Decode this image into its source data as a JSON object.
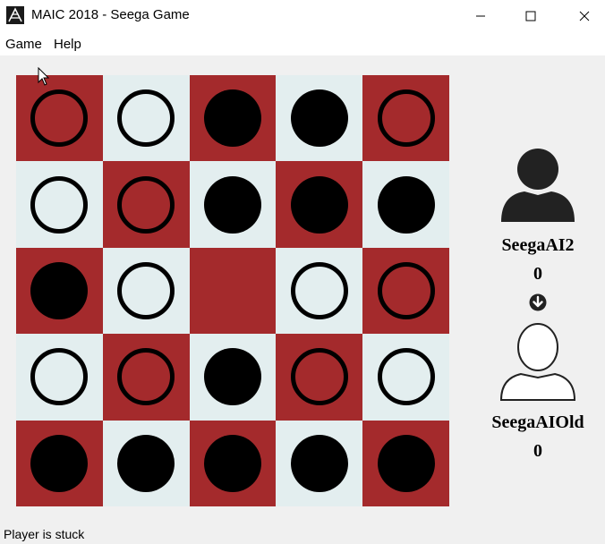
{
  "window": {
    "title": "MAIC 2018 - Seega Game"
  },
  "menu": {
    "items": [
      "Game",
      "Help"
    ]
  },
  "board": {
    "rows": [
      [
        "white",
        "white",
        "black",
        "black",
        "white"
      ],
      [
        "white",
        "white",
        "black",
        "black",
        "black"
      ],
      [
        "black",
        "white",
        "empty",
        "white",
        "white"
      ],
      [
        "white",
        "white",
        "black",
        "white",
        "white"
      ],
      [
        "black",
        "black",
        "black",
        "black",
        "black"
      ]
    ],
    "colors": {
      "dark_square": "#a42a2c",
      "light_square": "#e3eeef"
    }
  },
  "players": [
    {
      "name": "SeegaAI2",
      "score": "0",
      "avatar": "person-dark-icon"
    },
    {
      "name": "SeegaAIOld",
      "score": "0",
      "avatar": "person-outline-icon"
    }
  ],
  "turn_indicator": {
    "icon": "arrow-down-circle-icon",
    "points_to": "SeegaAIOld"
  },
  "status": {
    "text": "Player is stuck"
  }
}
